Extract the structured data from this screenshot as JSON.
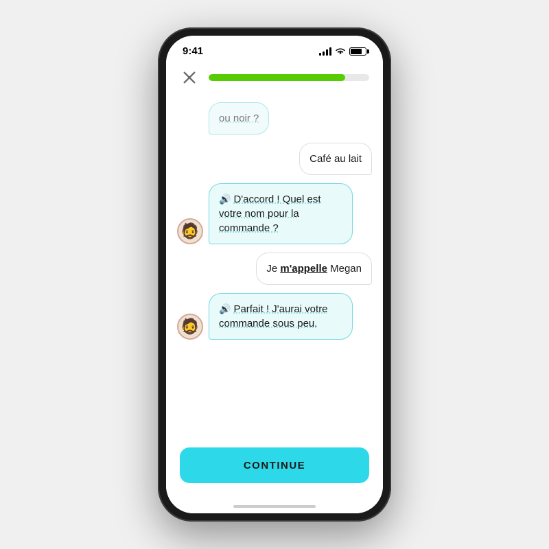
{
  "statusBar": {
    "time": "9:41"
  },
  "header": {
    "progress": 85
  },
  "messages": [
    {
      "id": "msg-partial",
      "type": "left-partial",
      "text": "ou noir ?"
    },
    {
      "id": "msg-cafe",
      "type": "right",
      "text": "Café au lait"
    },
    {
      "id": "msg-accord",
      "type": "left",
      "hasSpeaker": true,
      "text": "D'accord ! Quel est votre nom pour la commande ?"
    },
    {
      "id": "msg-megan",
      "type": "right",
      "text": "Je m'appelle Megan",
      "boldWord": "m'appelle"
    },
    {
      "id": "msg-parfait",
      "type": "left",
      "hasSpeaker": true,
      "text": "Parfait ! J'aurai votre commande sous peu."
    }
  ],
  "continueButton": {
    "label": "CONTINUE"
  },
  "avatar": {
    "emoji": "🧔"
  }
}
